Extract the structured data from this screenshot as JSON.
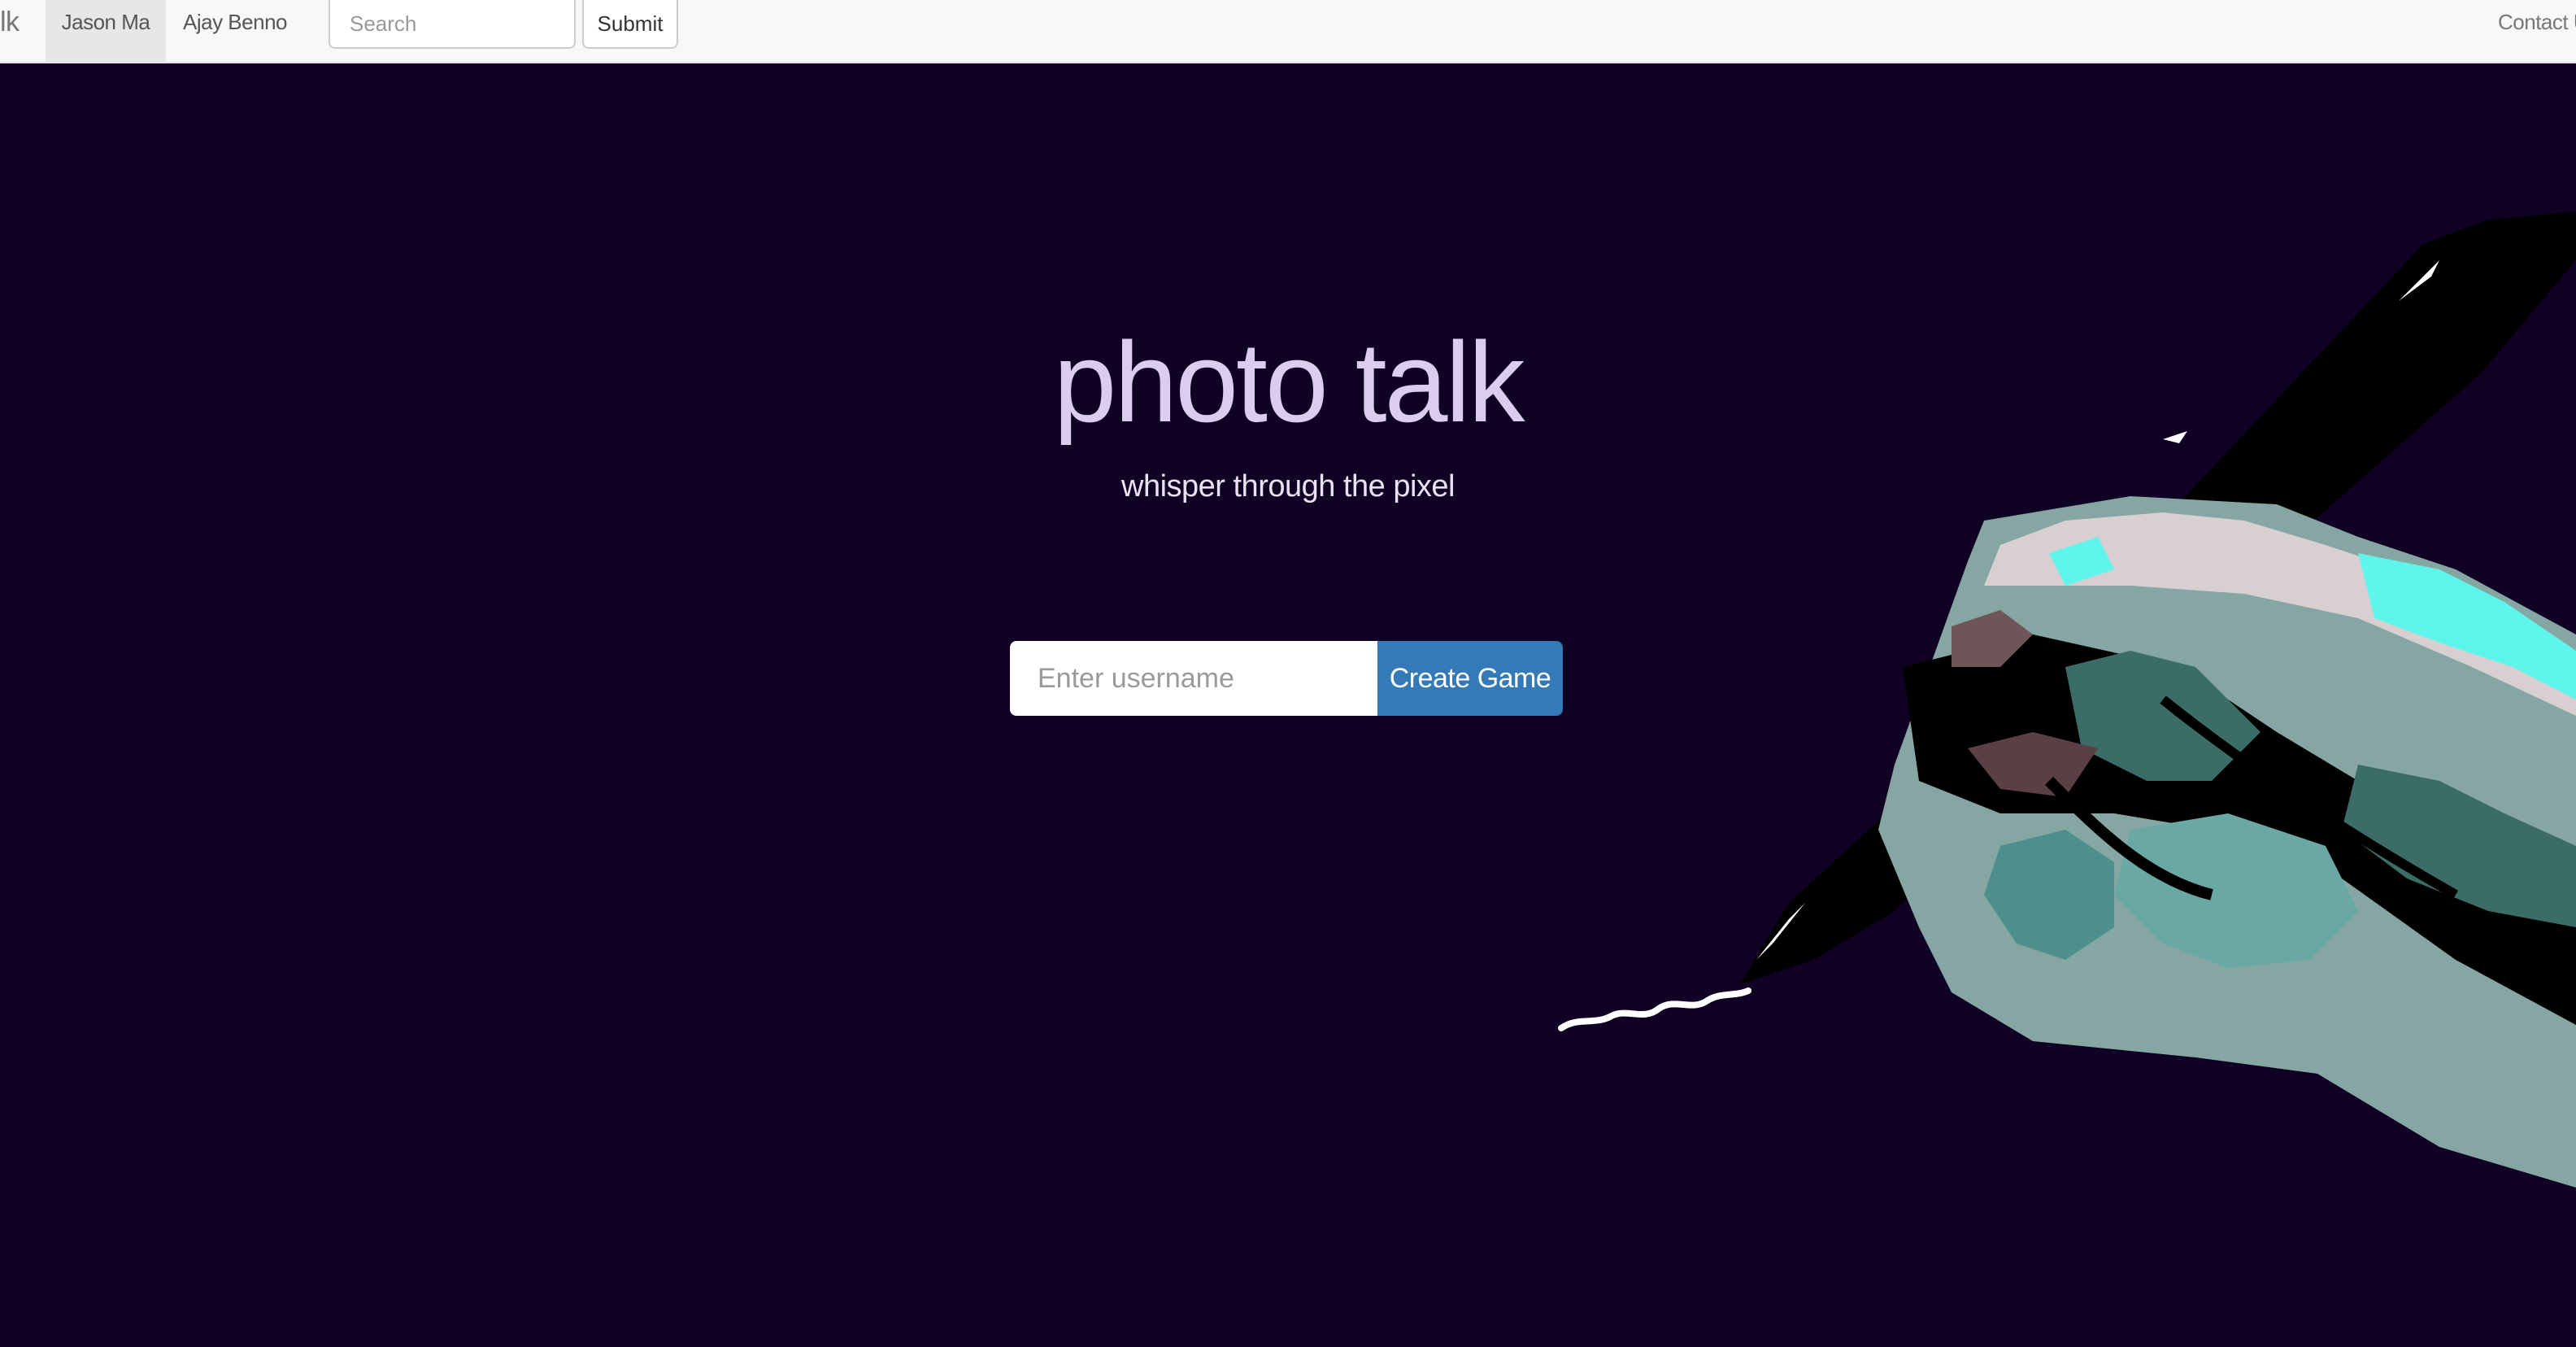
{
  "navbar": {
    "brand": "lk",
    "items": [
      {
        "label": "Jason Ma",
        "active": true
      },
      {
        "label": "Ajay Benno",
        "active": false
      }
    ],
    "search": {
      "placeholder": "Search",
      "value": ""
    },
    "submit_label": "Submit",
    "contact_label": "Contact U"
  },
  "hero": {
    "title": "photo talk",
    "subtitle": "whisper through the pixel",
    "username_placeholder": "Enter username",
    "username_value": "",
    "create_label": "Create Game"
  },
  "colors": {
    "background": "#100124",
    "accent_button": "#337ab7",
    "title": "#dccdef"
  },
  "illustration": {
    "icon": "hand-holding-pen-icon"
  }
}
